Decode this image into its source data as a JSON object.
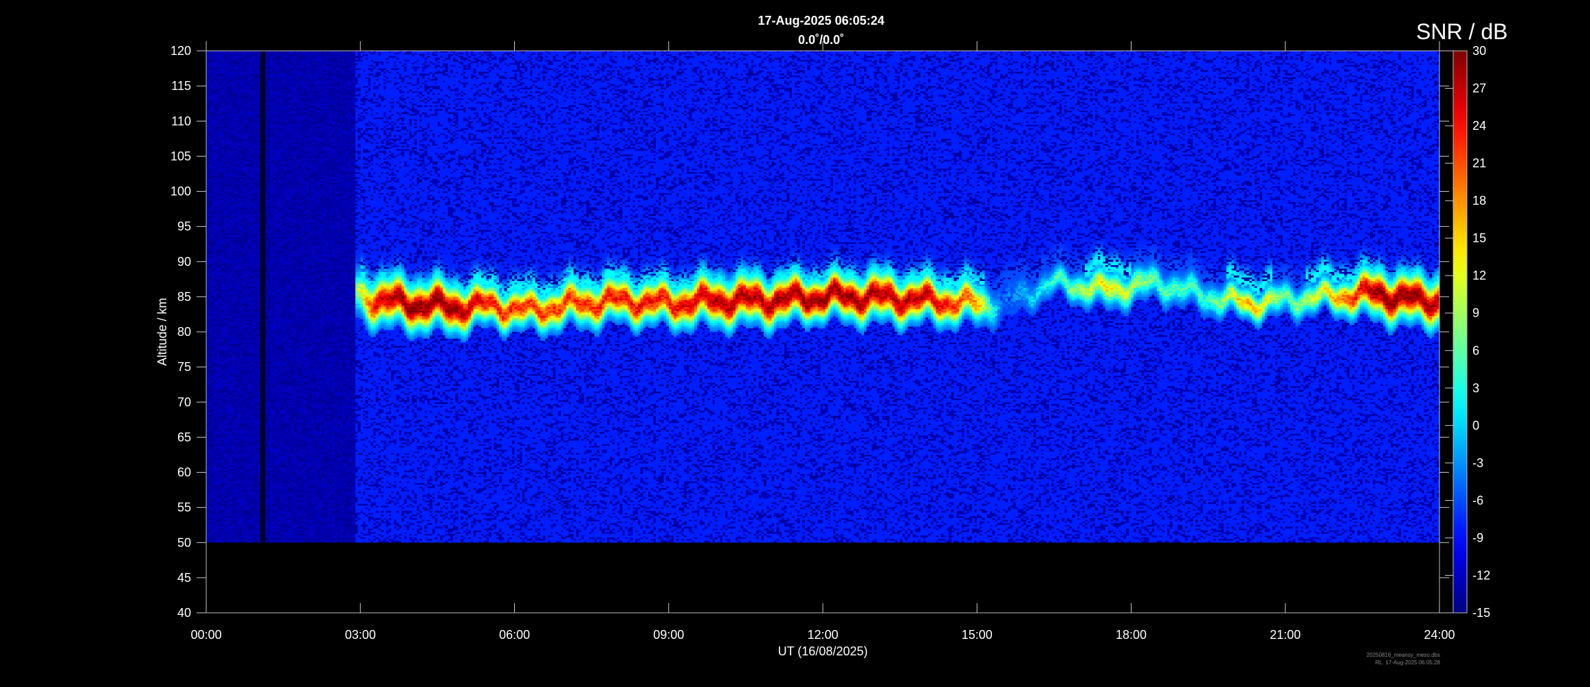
{
  "title_line1": "17-Aug-2025 06:05:24",
  "title_line2": "0.0˚/0.0˚",
  "colorbar_title": "SNR / dB",
  "file_line1": "20250816_meansy_meso.dbs",
  "file_line2": "RL. 17-Aug-2025 06:05:28",
  "chart_data": {
    "type": "heatmap",
    "xlabel": "UT (16/08/2025)",
    "ylabel": "Altitude / km",
    "x_tick_labels": [
      "00:00",
      "03:00",
      "06:00",
      "09:00",
      "12:00",
      "15:00",
      "18:00",
      "21:00",
      "24:00"
    ],
    "xlim_hours": [
      0,
      24
    ],
    "ylim_km": [
      40,
      120
    ],
    "y_ticks": [
      40,
      45,
      50,
      55,
      60,
      65,
      70,
      75,
      80,
      85,
      90,
      95,
      100,
      105,
      110,
      115,
      120
    ],
    "data_altitude_range_km": [
      50,
      120
    ],
    "data_gap_hour": 1.1,
    "colorbar_ticks": [
      -15,
      -12,
      -9,
      -6,
      -3,
      0,
      3,
      6,
      9,
      12,
      15,
      18,
      21,
      24,
      27,
      30
    ],
    "colorbar_range_db": [
      -15,
      30
    ],
    "colormap": "jet",
    "background_snr_db": -13,
    "echo_layer": [
      {
        "t": 2.9,
        "center": 85.5,
        "peak": 6,
        "width": 2.2
      },
      {
        "t": 3.3,
        "center": 84.5,
        "peak": 26,
        "width": 2.5
      },
      {
        "t": 4.0,
        "center": 84.0,
        "peak": 30,
        "width": 2.5
      },
      {
        "t": 4.8,
        "center": 83.5,
        "peak": 30,
        "width": 2.5
      },
      {
        "t": 5.5,
        "center": 83.8,
        "peak": 24,
        "width": 2.0
      },
      {
        "t": 6.3,
        "center": 83.0,
        "peak": 22,
        "width": 2.0
      },
      {
        "t": 7.2,
        "center": 84.0,
        "peak": 22,
        "width": 2.2
      },
      {
        "t": 8.0,
        "center": 84.5,
        "peak": 24,
        "width": 2.2
      },
      {
        "t": 9.0,
        "center": 84.0,
        "peak": 24,
        "width": 2.2
      },
      {
        "t": 10.0,
        "center": 84.5,
        "peak": 28,
        "width": 2.5
      },
      {
        "t": 11.0,
        "center": 84.5,
        "peak": 28,
        "width": 2.5
      },
      {
        "t": 12.0,
        "center": 85.0,
        "peak": 30,
        "width": 2.2
      },
      {
        "t": 13.0,
        "center": 85.0,
        "peak": 28,
        "width": 2.5
      },
      {
        "t": 14.0,
        "center": 84.5,
        "peak": 28,
        "width": 2.2
      },
      {
        "t": 15.0,
        "center": 84.0,
        "peak": 18,
        "width": 2.0
      },
      {
        "t": 15.5,
        "center": 84.0,
        "peak": -6,
        "width": 1.5
      },
      {
        "t": 16.5,
        "center": 87.0,
        "peak": 4,
        "width": 1.2
      },
      {
        "t": 17.5,
        "center": 86.0,
        "peak": 14,
        "width": 1.8
      },
      {
        "t": 18.5,
        "center": 87.0,
        "peak": 6,
        "width": 1.5
      },
      {
        "t": 19.5,
        "center": 85.0,
        "peak": 4,
        "width": 1.5
      },
      {
        "t": 20.3,
        "center": 84.0,
        "peak": 18,
        "width": 1.5
      },
      {
        "t": 21.0,
        "center": 84.5,
        "peak": 6,
        "width": 1.5
      },
      {
        "t": 21.8,
        "center": 85.0,
        "peak": 14,
        "width": 1.5
      },
      {
        "t": 22.8,
        "center": 85.5,
        "peak": 30,
        "width": 2.5
      },
      {
        "t": 23.5,
        "center": 84.5,
        "peak": 30,
        "width": 2.5
      },
      {
        "t": 24.0,
        "center": 84.5,
        "peak": 28,
        "width": 2.5
      }
    ]
  }
}
